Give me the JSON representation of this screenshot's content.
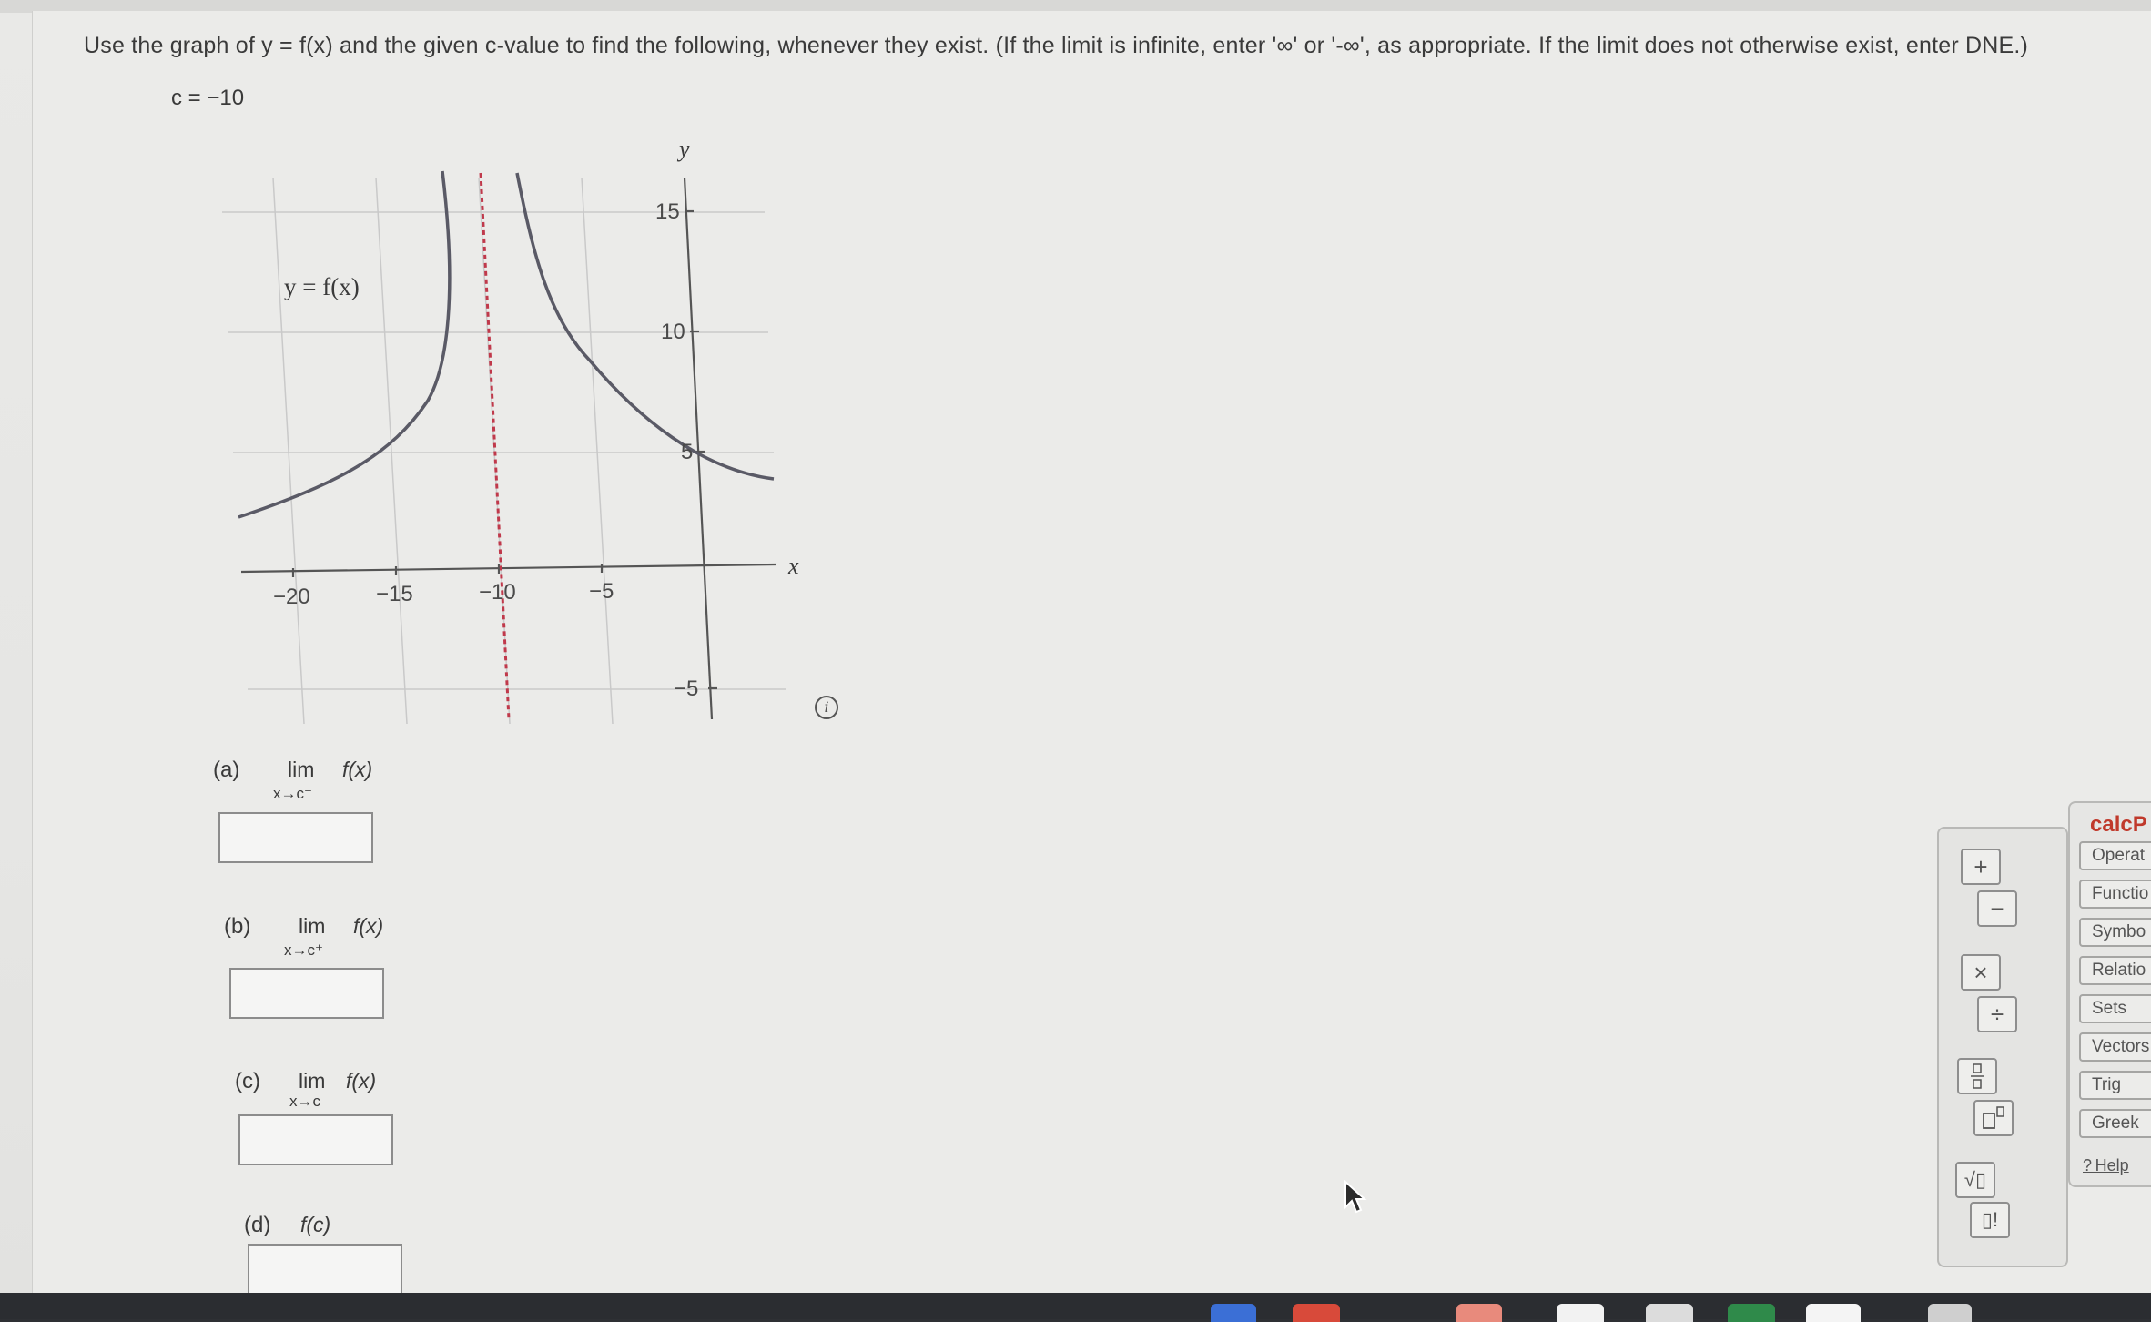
{
  "instructions": "Use the graph of y = f(x) and the given c-value to find the following, whenever they exist. (If the limit is infinite, enter '∞' or '-∞', as appropriate. If the limit does not otherwise exist, enter DNE.)",
  "c_value": "c = −10",
  "graph": {
    "y_axis_label": "y",
    "x_axis_label": "x",
    "function_label": "y = f(x)",
    "x_ticks": [
      "−20",
      "−15",
      "−10",
      "−5"
    ],
    "y_ticks": [
      "15",
      "10",
      "5",
      "−5"
    ]
  },
  "parts": [
    {
      "label": "(a)",
      "lim": "lim",
      "sub": "x→c⁻",
      "fx": "f(x)",
      "answer": ""
    },
    {
      "label": "(b)",
      "lim": "lim",
      "sub": "x→c⁺",
      "fx": "f(x)",
      "answer": ""
    },
    {
      "label": "(c)",
      "lim": "lim",
      "sub": "x→c",
      "fx": "f(x)",
      "answer": ""
    },
    {
      "label": "(d)",
      "fx": "f(c)",
      "answer": ""
    }
  ],
  "palette": {
    "plus": "+",
    "minus": "−",
    "times": "×",
    "divide": "÷",
    "fraction_icon": "fraction-icon",
    "power_icon": "power-icon",
    "sqrt": "√▯",
    "factorial": "▯!"
  },
  "calcpad": {
    "title": "calcP",
    "tabs": [
      "Operat",
      "Functio",
      "Symbo",
      "Relatio",
      "Sets",
      "Vectors",
      "Trig",
      "Greek"
    ],
    "help": "Help"
  }
}
